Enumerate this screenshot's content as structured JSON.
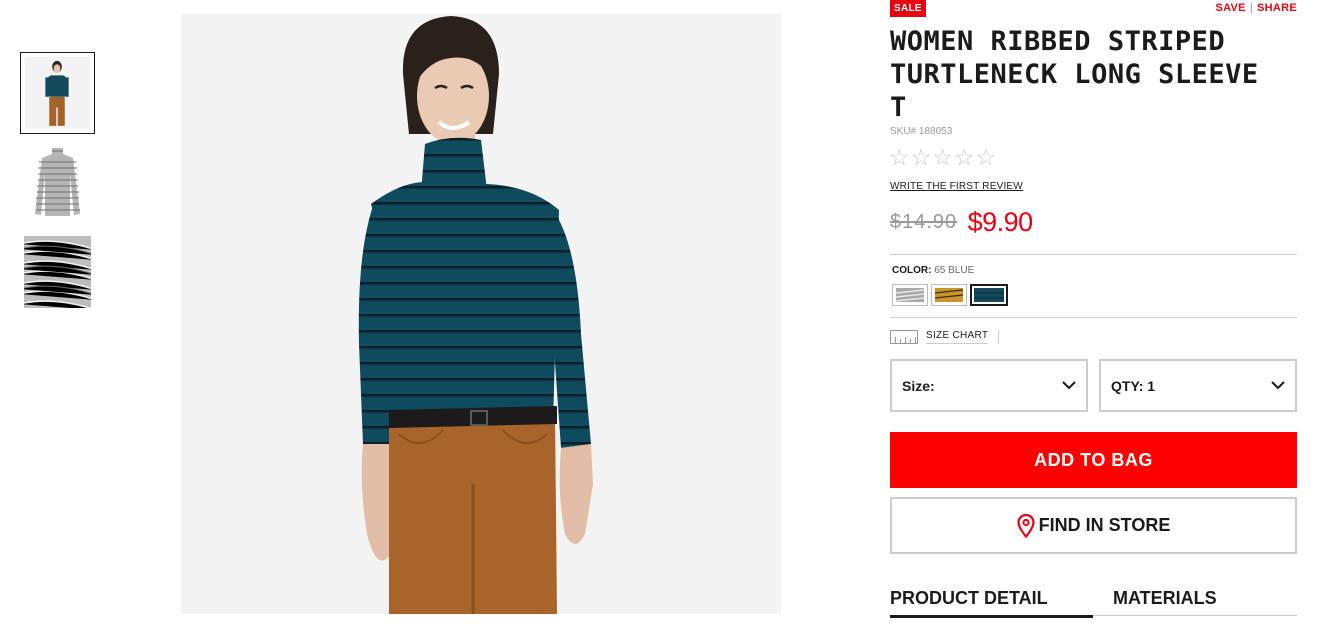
{
  "badge": "SALE",
  "actions": {
    "save": "SAVE",
    "separator": "|",
    "share": "SHARE"
  },
  "product": {
    "title": "WOMEN RIBBED STRIPED TURTLENECK LONG SLEEVE T",
    "sku": "SKU# 188053",
    "stars": "☆☆☆☆☆",
    "rating_stars": 0,
    "review_link": "WRITE THE FIRST REVIEW",
    "old_price": "$14.90",
    "price": "$9.90"
  },
  "color": {
    "label": "COLOR:",
    "value": "65 BLUE",
    "swatches": [
      {
        "name": "gray",
        "hex": "#9a9a9a"
      },
      {
        "name": "mustard",
        "hex": "#c8962a"
      },
      {
        "name": "blue",
        "hex": "#12485a",
        "selected": true
      }
    ]
  },
  "size_chart": "SIZE CHART",
  "selects": {
    "size": "Size:",
    "qty": "QTY: 1"
  },
  "buttons": {
    "add_to_bag": "ADD TO BAG",
    "find_in_store": "FIND IN STORE"
  },
  "tabs": [
    {
      "label": "PRODUCT DETAIL",
      "active": true
    },
    {
      "label": "MATERIALS"
    }
  ],
  "colors": {
    "accent": "#e60012",
    "button": "#ff0000",
    "text": "#1b1b1b"
  },
  "icons": {
    "location": "location-pin-icon",
    "chevron": "chevron-down-icon",
    "ruler": "ruler-icon"
  }
}
